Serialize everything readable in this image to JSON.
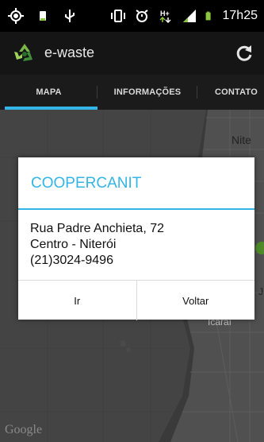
{
  "status_bar": {
    "time": "17h25",
    "icons": [
      "gps-icon",
      "android-notification-icon",
      "usb-icon",
      "vibrate-icon",
      "alarm-icon",
      "hspa-data-icon",
      "signal-icon",
      "battery-icon"
    ]
  },
  "action_bar": {
    "title": "e-waste",
    "logo": "recycle-logo-icon",
    "refresh": "refresh-icon"
  },
  "tabs": [
    {
      "label": "MAPA",
      "active": true
    },
    {
      "label": "INFORMAÇÕES",
      "active": false
    },
    {
      "label": "CONTATO",
      "active": false
    }
  ],
  "map": {
    "labels": {
      "niteroi": "Nite",
      "j": "J",
      "icarai": "Icaraí"
    },
    "attribution": "Google"
  },
  "dialog": {
    "title": "COOPERCANIT",
    "address_line1": "Rua Padre Anchieta, 72",
    "address_line2": "Centro - Niterói",
    "phone": "(21)3024-9496",
    "button_go": "Ir",
    "button_back": "Voltar"
  },
  "colors": {
    "accent": "#33b5e5",
    "action_bar": "#151515",
    "battery": "#8cc63f"
  }
}
